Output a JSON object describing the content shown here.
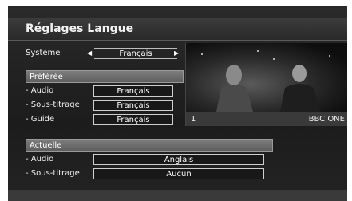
{
  "title": "Réglages Langue",
  "system": {
    "label": "Système",
    "value": "Français"
  },
  "preferred": {
    "header": "Préférée",
    "rows": [
      {
        "label": "- Audio",
        "value": "Français"
      },
      {
        "label": "- Sous-titrage",
        "value": "Français"
      },
      {
        "label": "- Guide",
        "value": "Français"
      }
    ]
  },
  "current": {
    "header": "Actuelle",
    "rows": [
      {
        "label": "- Audio",
        "value": "Anglais"
      },
      {
        "label": "- Sous-titrage",
        "value": "Aucun"
      }
    ]
  },
  "preview": {
    "channel_number": "1",
    "channel_name": "BBC ONE"
  },
  "icons": {
    "left_arrow": "left-arrow-icon",
    "right_arrow": "right-arrow-icon"
  }
}
